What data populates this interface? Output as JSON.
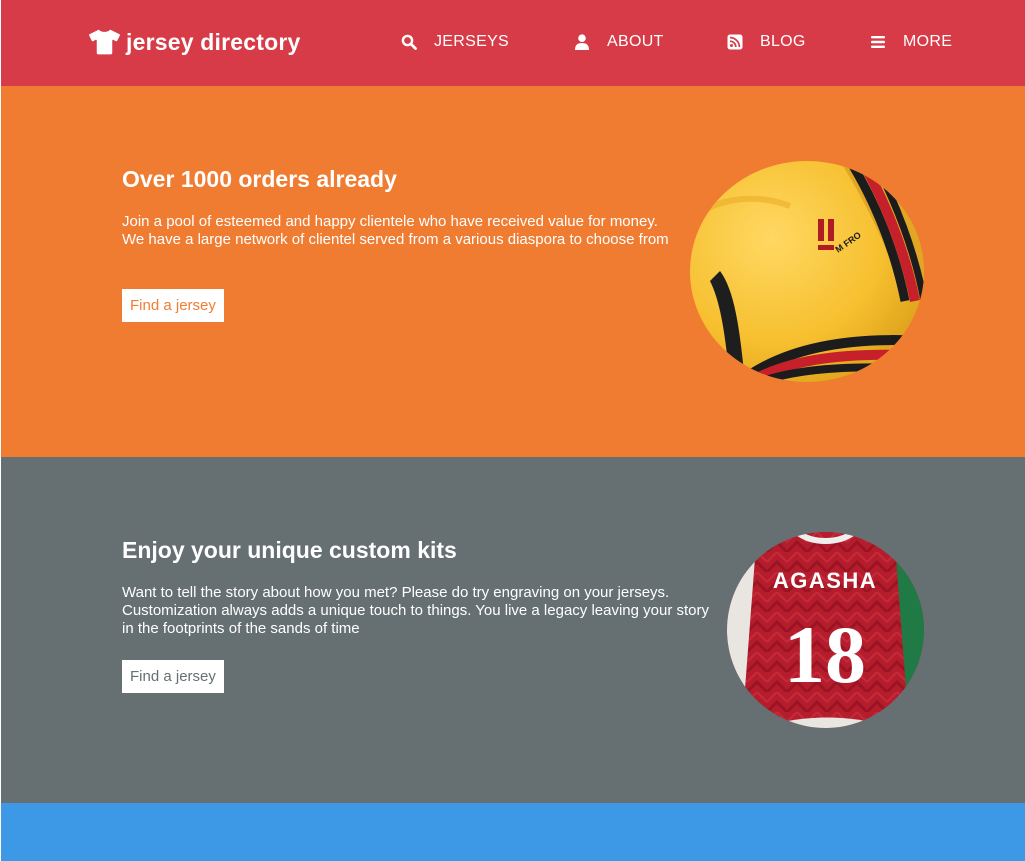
{
  "nav": {
    "brand": "jersey directory",
    "brand_icon": "tshirt-icon",
    "items": [
      {
        "label": "JERSEYS",
        "icon": "search-icon"
      },
      {
        "label": "ABOUT",
        "icon": "user-icon"
      },
      {
        "label": "BLOG",
        "icon": "rss-icon"
      },
      {
        "label": "MORE",
        "icon": "bars-icon"
      }
    ]
  },
  "sections": [
    {
      "heading": "Over 1000 orders already",
      "text": "Join a pool of esteemed and happy clientele who have received value for money. We have a large network of clientel served from a various diaspora to choose from",
      "button": "Find a jersey",
      "image_alt": "Yellow jersey sleeve with red and black stripes"
    },
    {
      "heading": "Enjoy your unique custom kits",
      "text": "Want to tell the story about how you met? Please do try engraving on your jerseys. Customization always adds a unique touch to things. You live a legacy leaving your story in the footprints of the sands of time",
      "button": "Find a jersey",
      "image_alt": "Red jersey with AGASHA 18 printed on back",
      "jersey_name": "AGASHA",
      "jersey_number": "18"
    }
  ],
  "colors": {
    "navbar": "#d63b47",
    "section1": "#f07c32",
    "section2": "#667073",
    "section3": "#3d99e6",
    "button1_text": "#f07c32",
    "button2_text": "#667073"
  }
}
